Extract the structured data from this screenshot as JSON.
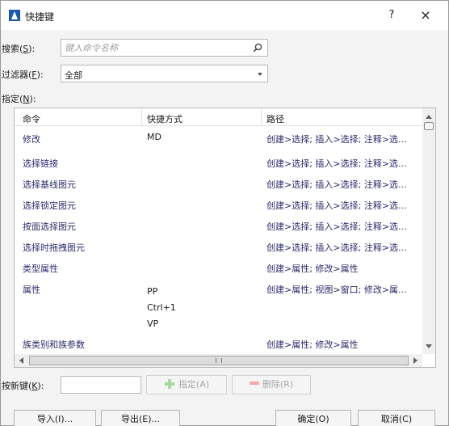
{
  "window": {
    "title": "快捷键"
  },
  "titlebar": {
    "help_label": "?",
    "close_label": "×"
  },
  "search": {
    "label": "搜索(",
    "accel": "S",
    "label_end": "):",
    "placeholder": "键入命令名称"
  },
  "filter": {
    "label": "过滤器(",
    "accel": "F",
    "label_end": "):",
    "value": "全部"
  },
  "assign_section": {
    "label": "指定(",
    "accel": "N",
    "label_end": "):"
  },
  "table": {
    "headers": [
      "命令",
      "快捷方式",
      "路径"
    ],
    "rows": [
      {
        "command": "修改",
        "shortcuts": [
          "MD"
        ],
        "path": "创建>选择; 插入>选择; 注释>选..."
      },
      {
        "command": "选择链接",
        "shortcuts": [],
        "path": "创建>选择; 插入>选择; 注释>选..."
      },
      {
        "command": "选择基线图元",
        "shortcuts": [],
        "path": "创建>选择; 插入>选择; 注释>选..."
      },
      {
        "command": "选择锁定图元",
        "shortcuts": [],
        "path": "创建>选择; 插入>选择; 注释>选..."
      },
      {
        "command": "按面选择图元",
        "shortcuts": [],
        "path": "创建>选择; 插入>选择; 注释>选..."
      },
      {
        "command": "选择时拖拽图元",
        "shortcuts": [],
        "path": "创建>选择; 插入>选择; 注释>选..."
      },
      {
        "command": "类型属性",
        "shortcuts": [],
        "path": "创建>属性; 修改>属性"
      },
      {
        "command": "属性",
        "shortcuts": [
          "PP",
          "Ctrl+1",
          "VP"
        ],
        "path": "创建>属性; 视图>窗口; 修改>属..."
      },
      {
        "command": "族类别和族参数",
        "shortcuts": [],
        "path": "创建>属性; 修改>属性"
      }
    ],
    "hscroll_grip": "III"
  },
  "new_key": {
    "label": "按新键(",
    "accel": "K",
    "label_end": "):",
    "value": ""
  },
  "buttons": {
    "assign": "指定(A)",
    "remove": "删除(R)",
    "import": "导入(I)...",
    "export": "导出(E)...",
    "ok": "确定(O)",
    "cancel": "取消(C)"
  },
  "colors": {
    "accent": "#1f58a8",
    "add_green": "#a8d8a0",
    "remove_red": "#f0a8a8"
  }
}
